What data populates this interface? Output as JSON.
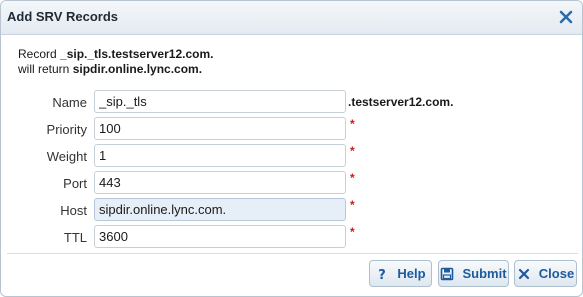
{
  "dialog": {
    "title": "Add SRV Records"
  },
  "summary": {
    "line1_prefix": "Record ",
    "record_name": "_sip._tls.testserver12.com.",
    "line2_prefix": "will return ",
    "target": "sipdir.online.lync.com."
  },
  "form": {
    "name_label": "Name",
    "name_value": "_sip._tls",
    "name_suffix": ".testserver12.com.",
    "priority_label": "Priority",
    "priority_value": "100",
    "weight_label": "Weight",
    "weight_value": "1",
    "port_label": "Port",
    "port_value": "443",
    "host_label": "Host",
    "host_value": "sipdir.online.lync.com.",
    "ttl_label": "TTL",
    "ttl_value": "3600",
    "required_mark": "*"
  },
  "buttons": {
    "help": "Help",
    "submit": "Submit",
    "close": "Close"
  },
  "icons": {
    "close": "close-icon",
    "help": "question-icon",
    "submit": "save-icon",
    "close_button": "x-icon"
  },
  "colors": {
    "button_text": "#1d5a9e",
    "required": "#cc1b1b",
    "active_field": "#e6eef8"
  }
}
